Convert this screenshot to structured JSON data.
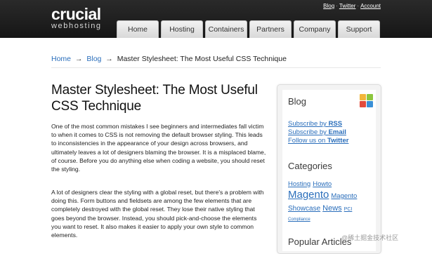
{
  "brand": {
    "name": "crucial",
    "tagline": "webhosting"
  },
  "utility_links": [
    "Blog",
    "Twitter",
    "Account"
  ],
  "nav": [
    "Home",
    "Hosting",
    "Containers",
    "Partners",
    "Company",
    "Support"
  ],
  "breadcrumb": {
    "items": [
      "Home",
      "Blog"
    ],
    "current": "Master Stylesheet: The Most Useful CSS Technique",
    "separator": "→"
  },
  "article": {
    "title": "Master Stylesheet: The Most Useful CSS Technique",
    "paragraphs": [
      "One of the most common mistakes I see beginners and intermediates fall victim to when it comes to CSS is not removing the default browser styling. This leads to inconsistencies in the appearance of your design across browsers, and ultimately leaves a lot of designers blaming the browser. It is a misplaced blame, of course. Before you do anything else when coding a website, you should reset the styling.",
      "A lot of designers clear the styling with a global reset, but there's a problem with doing this. Form buttons and fieldsets are among the few elements that are completely destroyed with the global reset. They lose their native styling that goes beyond the browser. Instead, you should pick-and-choose the elements you want to reset. It also makes it easier to apply your own style to common elements."
    ]
  },
  "sidebar": {
    "blog_heading": "Blog",
    "subscribe": [
      {
        "prefix": "Subscribe by ",
        "bold": "RSS"
      },
      {
        "prefix": "Subscribe by ",
        "bold": "Email"
      },
      {
        "prefix": "Follow us on ",
        "bold": "Twitter"
      }
    ],
    "categories_heading": "Categories",
    "tags": [
      "Hosting",
      "Howto",
      "Magento",
      "Magento",
      "Showcase",
      "News",
      "PCI",
      "Compliance"
    ],
    "popular_heading": "Popular Articles"
  },
  "watermark": "@稀土掘金技术社区",
  "colors": {
    "link": "#2a6ebb",
    "header_bg": "#1e1e1e"
  }
}
